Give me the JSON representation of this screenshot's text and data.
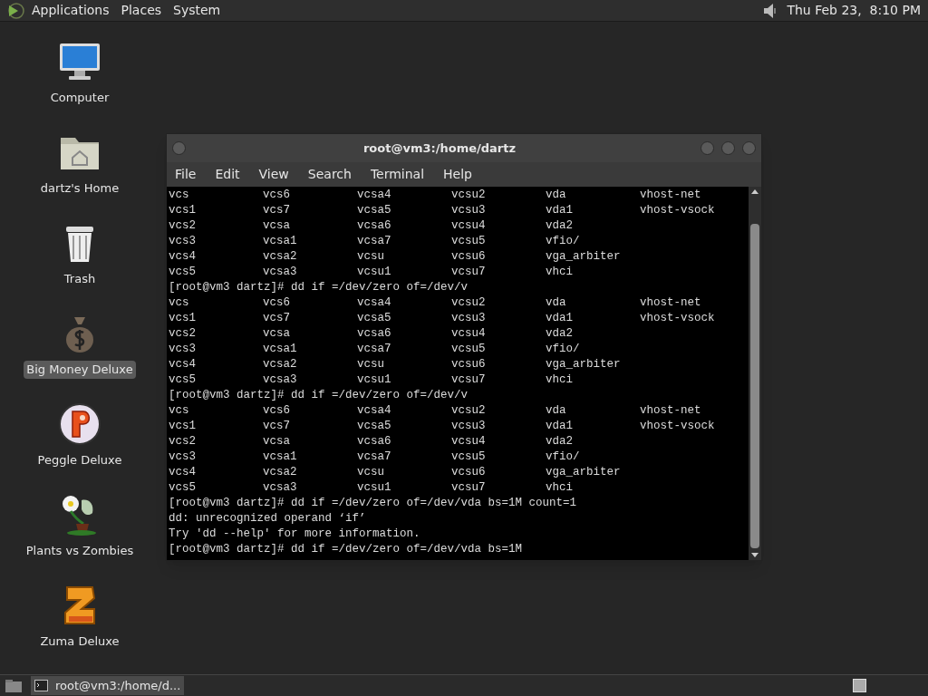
{
  "top_panel": {
    "menus": [
      "Applications",
      "Places",
      "System"
    ],
    "clock": "Thu Feb 23,  8:10 PM"
  },
  "desktop_icons": [
    {
      "kind": "computer",
      "label": "Computer",
      "selected": false
    },
    {
      "kind": "home",
      "label": "dartz's Home",
      "selected": false
    },
    {
      "kind": "trash",
      "label": "Trash",
      "selected": false
    },
    {
      "kind": "money",
      "label": "Big Money Deluxe",
      "selected": true
    },
    {
      "kind": "peggle",
      "label": "Peggle Deluxe",
      "selected": false
    },
    {
      "kind": "plants",
      "label": "Plants vs Zombies",
      "selected": false
    },
    {
      "kind": "zuma",
      "label": "Zuma Deluxe",
      "selected": false
    }
  ],
  "window": {
    "title": "root@vm3:/home/dartz",
    "menus": [
      "File",
      "Edit",
      "View",
      "Search",
      "Terminal",
      "Help"
    ],
    "lines": [
      {
        "kind": "files",
        "cells": [
          "vcs",
          "vcs6",
          "vcsa4",
          "vcsu2",
          "vda",
          "vhost-net"
        ]
      },
      {
        "kind": "files",
        "cells": [
          "vcs1",
          "vcs7",
          "vcsa5",
          "vcsu3",
          "vda1",
          "vhost-vsock"
        ]
      },
      {
        "kind": "files",
        "cells": [
          "vcs2",
          "vcsa",
          "vcsa6",
          "vcsu4",
          "vda2"
        ]
      },
      {
        "kind": "files",
        "cells": [
          "vcs3",
          "vcsa1",
          "vcsa7",
          "vcsu5",
          "vfio/"
        ]
      },
      {
        "kind": "files",
        "cells": [
          "vcs4",
          "vcsa2",
          "vcsu",
          "vcsu6",
          "vga_arbiter"
        ]
      },
      {
        "kind": "files",
        "cells": [
          "vcs5",
          "vcsa3",
          "vcsu1",
          "vcsu7",
          "vhci"
        ]
      },
      {
        "kind": "text",
        "text": "[root@vm3 dartz]# dd if =/dev/zero of=/dev/v"
      },
      {
        "kind": "files",
        "cells": [
          "vcs",
          "vcs6",
          "vcsa4",
          "vcsu2",
          "vda",
          "vhost-net"
        ]
      },
      {
        "kind": "files",
        "cells": [
          "vcs1",
          "vcs7",
          "vcsa5",
          "vcsu3",
          "vda1",
          "vhost-vsock"
        ]
      },
      {
        "kind": "files",
        "cells": [
          "vcs2",
          "vcsa",
          "vcsa6",
          "vcsu4",
          "vda2"
        ]
      },
      {
        "kind": "files",
        "cells": [
          "vcs3",
          "vcsa1",
          "vcsa7",
          "vcsu5",
          "vfio/"
        ]
      },
      {
        "kind": "files",
        "cells": [
          "vcs4",
          "vcsa2",
          "vcsu",
          "vcsu6",
          "vga_arbiter"
        ]
      },
      {
        "kind": "files",
        "cells": [
          "vcs5",
          "vcsa3",
          "vcsu1",
          "vcsu7",
          "vhci"
        ]
      },
      {
        "kind": "text",
        "text": "[root@vm3 dartz]# dd if =/dev/zero of=/dev/v"
      },
      {
        "kind": "files",
        "cells": [
          "vcs",
          "vcs6",
          "vcsa4",
          "vcsu2",
          "vda",
          "vhost-net"
        ]
      },
      {
        "kind": "files",
        "cells": [
          "vcs1",
          "vcs7",
          "vcsa5",
          "vcsu3",
          "vda1",
          "vhost-vsock"
        ]
      },
      {
        "kind": "files",
        "cells": [
          "vcs2",
          "vcsa",
          "vcsa6",
          "vcsu4",
          "vda2"
        ]
      },
      {
        "kind": "files",
        "cells": [
          "vcs3",
          "vcsa1",
          "vcsa7",
          "vcsu5",
          "vfio/"
        ]
      },
      {
        "kind": "files",
        "cells": [
          "vcs4",
          "vcsa2",
          "vcsu",
          "vcsu6",
          "vga_arbiter"
        ]
      },
      {
        "kind": "files",
        "cells": [
          "vcs5",
          "vcsa3",
          "vcsu1",
          "vcsu7",
          "vhci"
        ]
      },
      {
        "kind": "text",
        "text": "[root@vm3 dartz]# dd if =/dev/zero of=/dev/vda bs=1M count=1"
      },
      {
        "kind": "text",
        "text": "dd: unrecognized operand ‘if’"
      },
      {
        "kind": "text",
        "text": "Try 'dd --help' for more information."
      },
      {
        "kind": "text",
        "text": "[root@vm3 dartz]# dd if =/dev/zero of=/dev/vda bs=1M"
      }
    ]
  },
  "taskbar": {
    "tasks": [
      {
        "label": "root@vm3:/home/d...",
        "selected": true
      }
    ]
  }
}
